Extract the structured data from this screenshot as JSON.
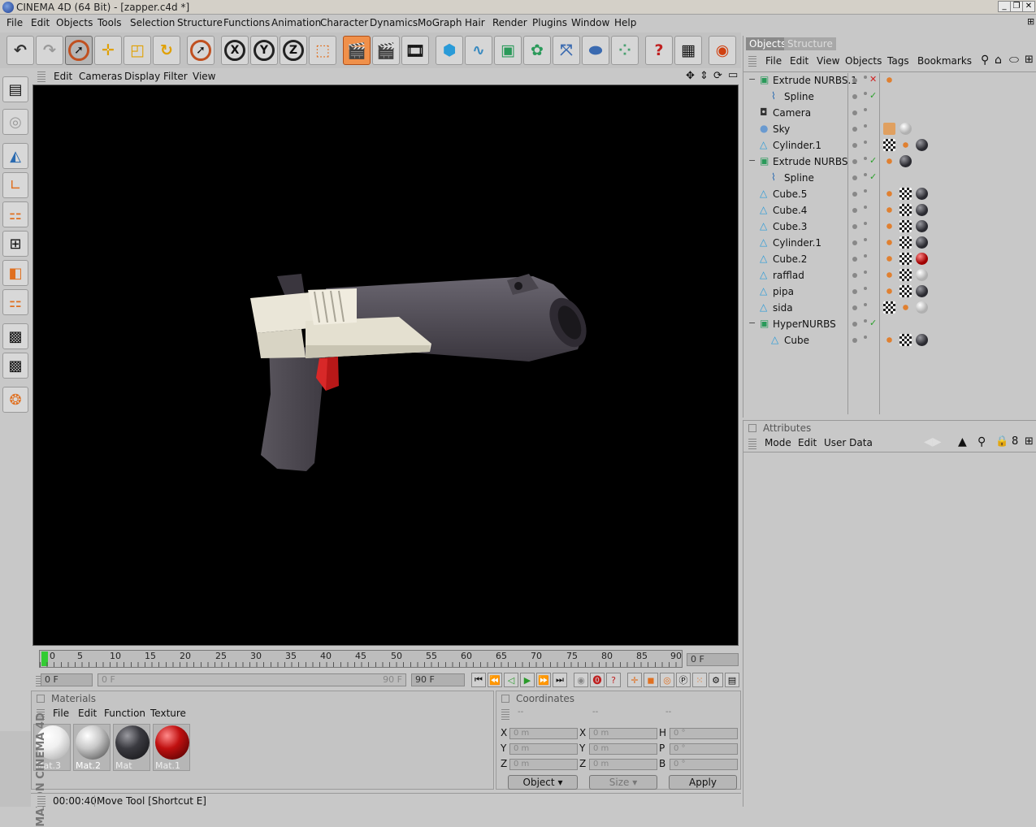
{
  "window": {
    "title": "CINEMA 4D (64 Bit) - [zapper.c4d *]",
    "controls": [
      "_",
      "❐",
      "✕"
    ]
  },
  "menu": [
    "File",
    "Edit",
    "Objects",
    "Tools",
    "Selection",
    "Structure",
    "Functions",
    "Animation",
    "Character",
    "Dynamics",
    "MoGraph",
    "Hair",
    "Render",
    "Plugins",
    "Window",
    "Help"
  ],
  "viewport": {
    "menu": [
      "Edit",
      "Cameras",
      "Display",
      "Filter",
      "View"
    ]
  },
  "timeline": {
    "ticks": [
      "0",
      "5",
      "10",
      "15",
      "20",
      "25",
      "30",
      "35",
      "40",
      "45",
      "50",
      "55",
      "60",
      "65",
      "70",
      "75",
      "80",
      "85",
      "90"
    ],
    "current_frame": "0 F",
    "start_field": "0 F",
    "range_left": "0 F",
    "range_right": "90 F",
    "end_field": "90 F"
  },
  "materials": {
    "title": "Materials",
    "menu": [
      "File",
      "Edit",
      "Function",
      "Texture"
    ],
    "items": [
      {
        "name": "Mat.3",
        "color": "#ffffff"
      },
      {
        "name": "Mat.2",
        "color": "#dcdcdc"
      },
      {
        "name": "Mat",
        "color": "#3a3a40"
      },
      {
        "name": "Mat.1",
        "color": "#c01010"
      }
    ]
  },
  "coordinates": {
    "title": "Coordinates",
    "headers": [
      "--",
      "--",
      "--"
    ],
    "rows": [
      {
        "a": "X",
        "av": "0 m",
        "b": "X",
        "bv": "0 m",
        "c": "H",
        "cv": "0 °"
      },
      {
        "a": "Y",
        "av": "0 m",
        "b": "Y",
        "bv": "0 m",
        "c": "P",
        "cv": "0 °"
      },
      {
        "a": "Z",
        "av": "0 m",
        "b": "Z",
        "bv": "0 m",
        "c": "B",
        "cv": "0 °"
      }
    ],
    "mode": "Object",
    "size": "Size",
    "apply": "Apply"
  },
  "status": {
    "time": "00:00:40",
    "text": "Move Tool [Shortcut E]"
  },
  "brand": "MAXON CINEMA 4D",
  "objects_panel": {
    "tabs": [
      "Objects",
      "Structure"
    ],
    "menu": [
      "File",
      "Edit",
      "View",
      "Objects",
      "Tags",
      "Bookmarks"
    ],
    "items": [
      {
        "name": "Extrude NURBS.1",
        "indent": 0,
        "kind": "nurbs",
        "expand": "−"
      },
      {
        "name": "Spline",
        "indent": 1,
        "kind": "spline",
        "expand": ""
      },
      {
        "name": "Camera",
        "indent": 0,
        "kind": "camera",
        "expand": ""
      },
      {
        "name": "Sky",
        "indent": 0,
        "kind": "sky",
        "expand": ""
      },
      {
        "name": "Cylinder.1",
        "indent": 0,
        "kind": "prim",
        "expand": ""
      },
      {
        "name": "Extrude NURBS",
        "indent": 0,
        "kind": "nurbs",
        "expand": "−"
      },
      {
        "name": "Spline",
        "indent": 1,
        "kind": "spline",
        "expand": ""
      },
      {
        "name": "Cube.5",
        "indent": 0,
        "kind": "prim",
        "expand": ""
      },
      {
        "name": "Cube.4",
        "indent": 0,
        "kind": "prim",
        "expand": ""
      },
      {
        "name": "Cube.3",
        "indent": 0,
        "kind": "prim",
        "expand": ""
      },
      {
        "name": "Cylinder.1",
        "indent": 0,
        "kind": "prim",
        "expand": ""
      },
      {
        "name": "Cube.2",
        "indent": 0,
        "kind": "prim",
        "expand": ""
      },
      {
        "name": "rafflad",
        "indent": 0,
        "kind": "prim",
        "expand": ""
      },
      {
        "name": "pipa",
        "indent": 0,
        "kind": "prim",
        "expand": ""
      },
      {
        "name": "sida",
        "indent": 0,
        "kind": "prim",
        "expand": ""
      },
      {
        "name": "HyperNURBS",
        "indent": 0,
        "kind": "nurbs",
        "expand": "−"
      },
      {
        "name": "Cube",
        "indent": 1,
        "kind": "prim",
        "expand": ""
      }
    ]
  },
  "attributes_panel": {
    "title": "Attributes",
    "menu": [
      "Mode",
      "Edit",
      "User Data"
    ]
  }
}
